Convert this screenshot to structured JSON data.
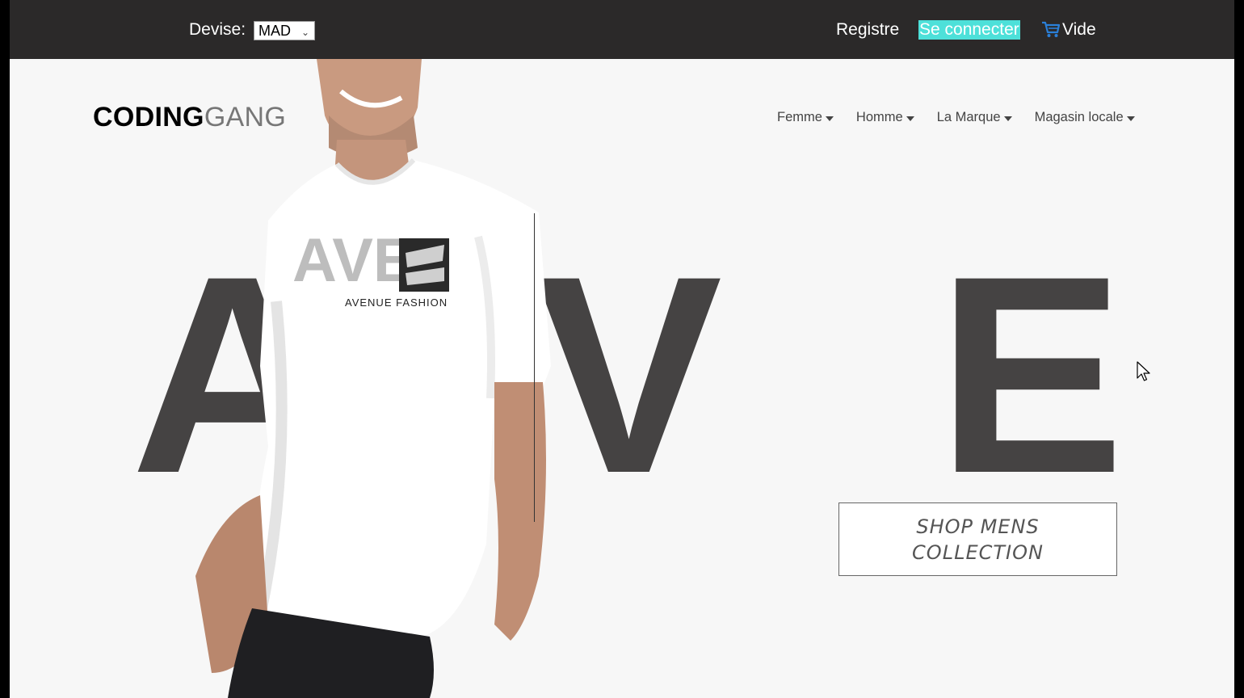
{
  "topbar": {
    "currency_label": "Devise:",
    "currency_value": "MAD",
    "register": "Registre",
    "login": "Se connecter",
    "cart_label": "Vide",
    "login_highlight_color": "#4de0d9",
    "background_color": "#2b2929"
  },
  "brand": {
    "bold": "CODING",
    "light": "GANG"
  },
  "nav": {
    "items": [
      {
        "label": "Femme"
      },
      {
        "label": "Homme"
      },
      {
        "label": "La Marque"
      },
      {
        "label": "Magasin locale"
      }
    ]
  },
  "hero": {
    "letters": [
      "A",
      "V",
      "E"
    ],
    "shirt_logo_letters": "AVE",
    "shirt_brand": "AVENUE FASHION",
    "cta_line1": "SHOP MENS",
    "cta_line2": "COLLECTION",
    "letter_color": "#454343"
  },
  "icons": {
    "cart": "shopping-cart-icon",
    "dropdown": "caret-down-icon",
    "cursor": "mouse-pointer-icon"
  }
}
